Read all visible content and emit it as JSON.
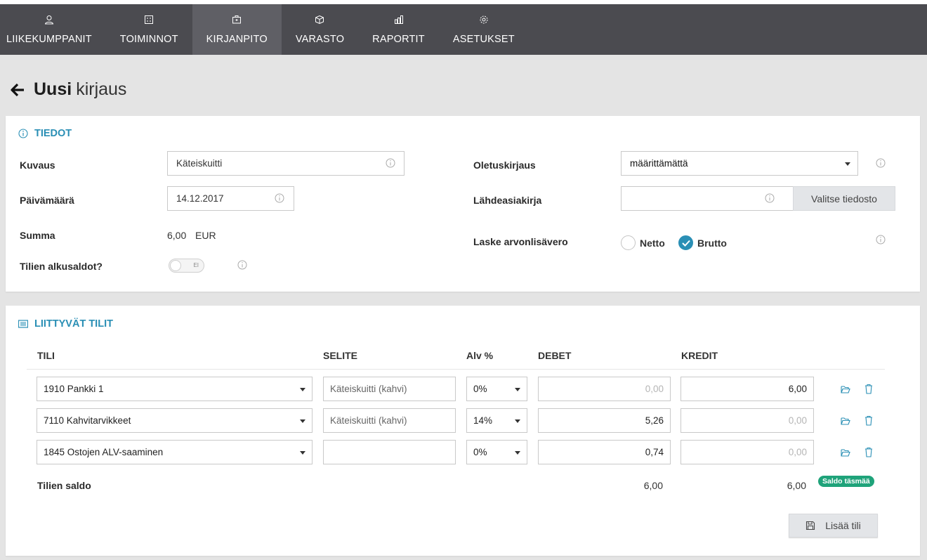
{
  "nav": {
    "items": [
      {
        "label": "LIIKEKUMPPANIT",
        "icon": "user-icon"
      },
      {
        "label": "TOIMINNOT",
        "icon": "calculator-icon"
      },
      {
        "label": "KIRJANPITO",
        "icon": "briefcase-icon",
        "active": true
      },
      {
        "label": "VARASTO",
        "icon": "cube-icon"
      },
      {
        "label": "RAPORTIT",
        "icon": "bar-chart-icon"
      },
      {
        "label": "ASETUKSET",
        "icon": "gear-icon"
      }
    ]
  },
  "page": {
    "title_bold": "Uusi",
    "title_light": "kirjaus"
  },
  "tiedot": {
    "section_title": "TIEDOT",
    "kuvaus_label": "Kuvaus",
    "kuvaus_value": "Käteiskuitti",
    "paivamaara_label": "Päivämäärä",
    "paivamaara_value": "14.12.2017",
    "summa_label": "Summa",
    "summa_value": "6,00",
    "summa_currency": "EUR",
    "alkusaldot_label": "Tilien alkusaldot?",
    "alkusaldot_toggle": "EI",
    "oletuskirjaus_label": "Oletuskirjaus",
    "oletuskirjaus_value": "määrittämättä",
    "lahdeasiakirja_label": "Lähdeasiakirja",
    "lahdeasiakirja_value": "",
    "valitse_button": "Valitse tiedosto",
    "alv_label": "Laske arvonlisävero",
    "netto_label": "Netto",
    "brutto_label": "Brutto"
  },
  "tilit": {
    "section_title": "LIITTYVÄT TILIT",
    "headers": {
      "tili": "TILI",
      "selite": "SELITE",
      "alv": "Alv %",
      "debet": "DEBET",
      "kredit": "KREDIT"
    },
    "rows": [
      {
        "tili": "1910 Pankki 1",
        "selite": "Käteiskuitti (kahvi)",
        "alv": "0%",
        "debet": "0,00",
        "kredit": "6,00"
      },
      {
        "tili": "7110 Kahvitarvikkeet",
        "selite": "Käteiskuitti (kahvi)",
        "alv": "14%",
        "debet": "5,26",
        "kredit": "0,00"
      },
      {
        "tili": "1845 Ostojen ALV-saaminen",
        "selite": "",
        "alv": "0%",
        "debet": "0,74",
        "kredit": "0,00"
      }
    ],
    "saldo_label": "Tilien saldo",
    "saldo_debet": "6,00",
    "saldo_kredit": "6,00",
    "saldo_badge": "Saldo täsmää",
    "add_button": "Lisää tili"
  },
  "colors": {
    "navbar": "#4b4b50",
    "accent": "#2a8fb5",
    "badge": "#1fa37a"
  }
}
